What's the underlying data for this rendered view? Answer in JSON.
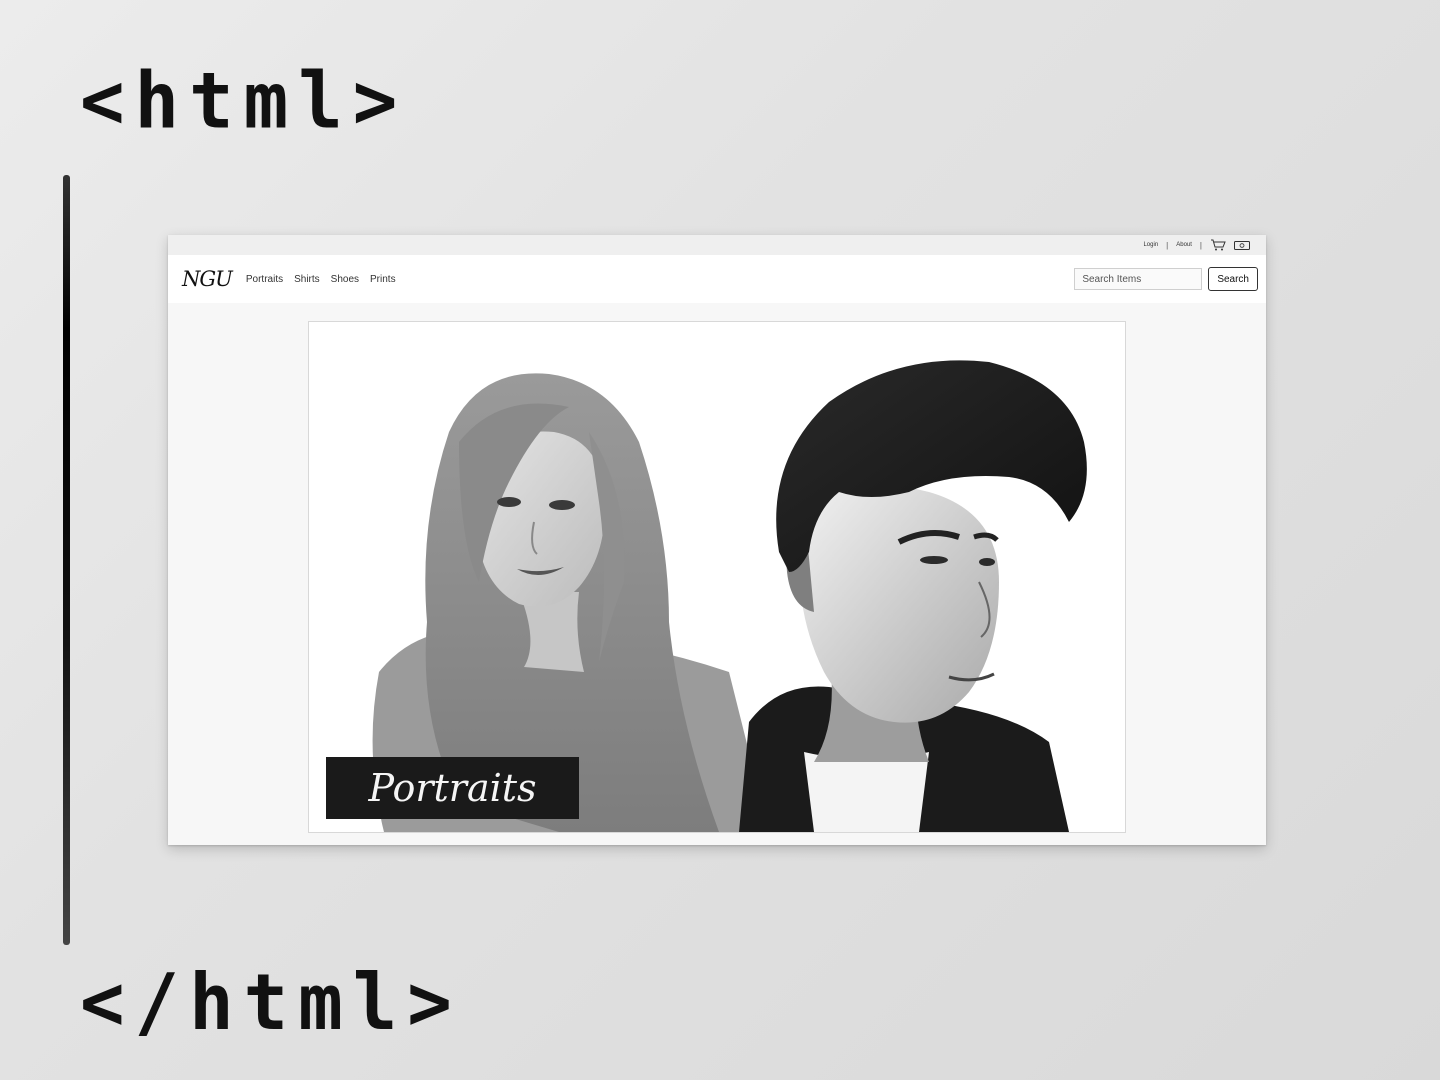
{
  "decor": {
    "open_tag": "<html>",
    "close_tag": "</html>"
  },
  "utility": {
    "login": "Login",
    "about": "About",
    "separator": "|",
    "cart_icon": "cart-icon",
    "money_icon": "cash-icon"
  },
  "nav": {
    "brand": "NGU",
    "links": [
      "Portraits",
      "Shirts",
      "Shoes",
      "Prints"
    ]
  },
  "search": {
    "placeholder": "Search Items",
    "button": "Search"
  },
  "hero": {
    "label": "Portraits"
  },
  "colors": {
    "background": "#e4e4e4",
    "card": "#f7f7f7",
    "navbar": "#ffffff",
    "label_bg": "#1a1a1a"
  }
}
